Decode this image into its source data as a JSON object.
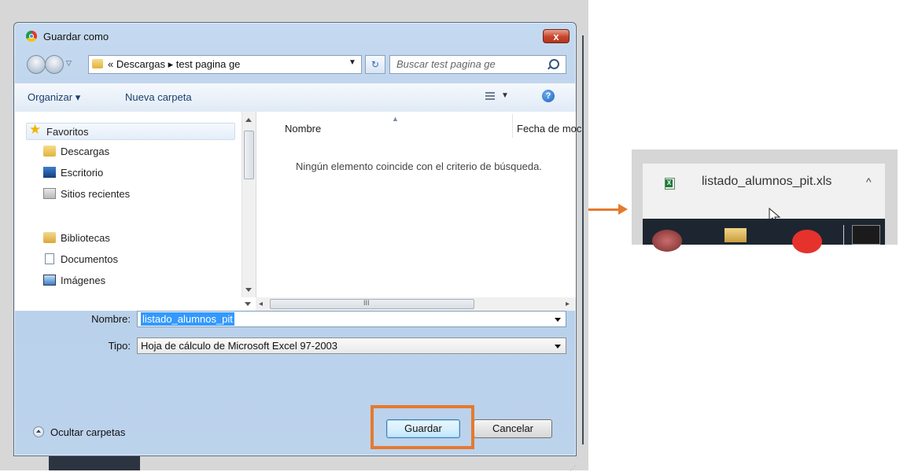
{
  "dialog": {
    "title": "Guardar como",
    "close_label": "x",
    "address": {
      "path": "« Descargas ▸ test pagina ge"
    },
    "search": {
      "placeholder": "Buscar test pagina ge"
    },
    "toolbar": {
      "organize_label": "Organizar ▾",
      "new_folder_label": "Nueva carpeta"
    },
    "nav": {
      "items": [
        {
          "label": "Favoritos",
          "icon": "star-icon"
        },
        {
          "label": "Descargas",
          "icon": "downloads-folder-icon"
        },
        {
          "label": "Escritorio",
          "icon": "desktop-icon"
        },
        {
          "label": "Sitios recientes",
          "icon": "recent-places-icon"
        },
        {
          "label": "Bibliotecas",
          "icon": "libraries-icon"
        },
        {
          "label": "Documentos",
          "icon": "documents-icon"
        },
        {
          "label": "Imágenes",
          "icon": "images-icon"
        }
      ]
    },
    "files": {
      "columns": [
        "Nombre",
        "Fecha de moc"
      ],
      "empty_message": "Ningún elemento coincide con el criterio de búsqueda.",
      "hscroll_mark": "III"
    },
    "form": {
      "name_label": "Nombre:",
      "name_value": "listado_alumnos_pit",
      "type_label": "Tipo:",
      "type_value": "Hoja de cálculo de Microsoft Excel 97-2003"
    },
    "footer": {
      "hide_folders_label": "Ocultar carpetas",
      "save_label": "Guardar",
      "cancel_label": "Cancelar"
    }
  },
  "download_bar": {
    "file_name": "listado_alumnos_pit.xls",
    "chevron": "^"
  },
  "colors": {
    "highlight": "#e57a2f",
    "selection": "#3399ff",
    "dialog_chrome": "#bcd3ec"
  }
}
